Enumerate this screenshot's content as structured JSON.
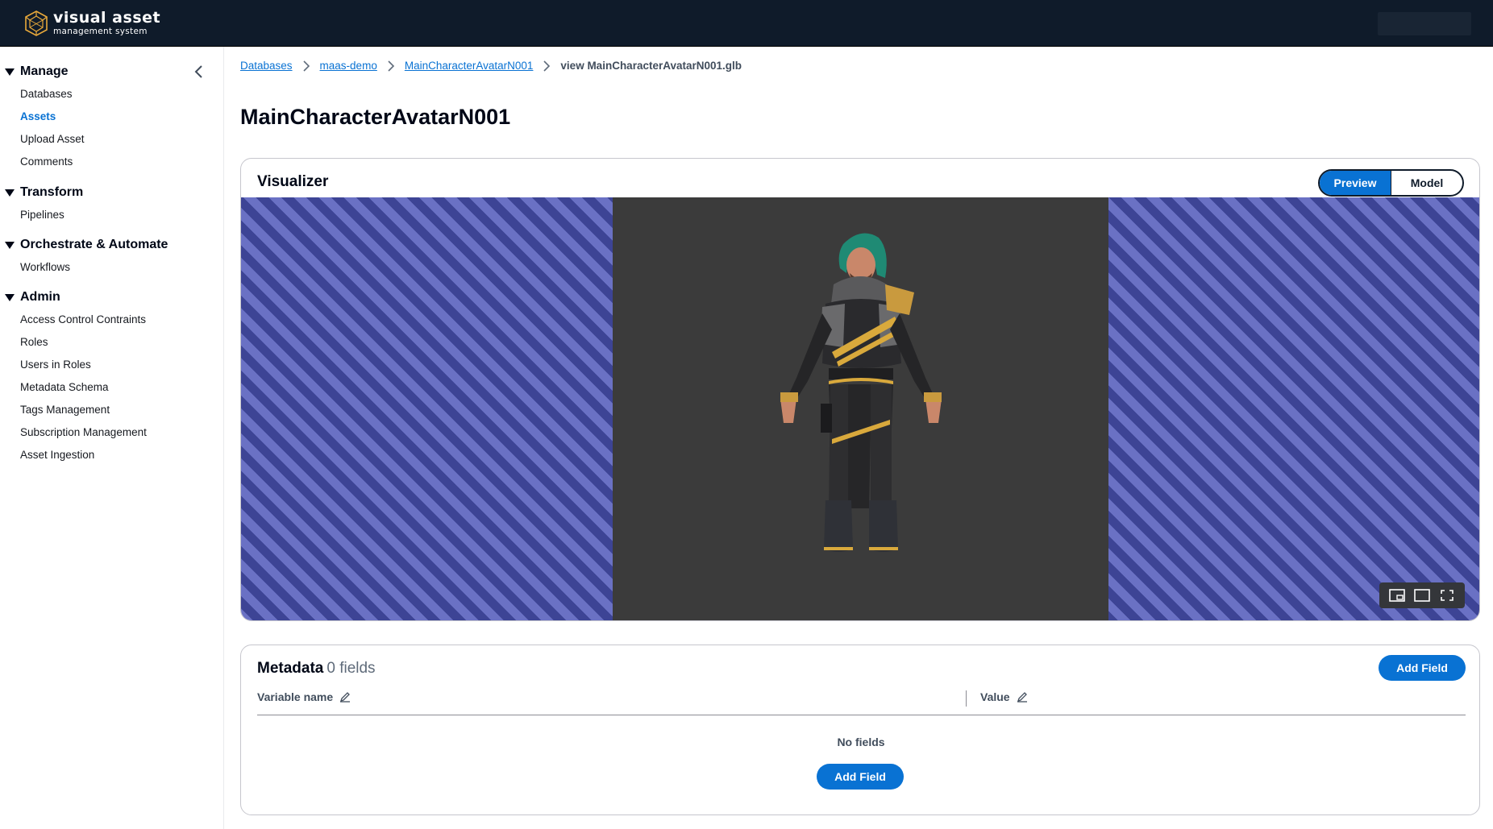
{
  "app": {
    "logo_title": "visual asset",
    "logo_subtitle": "management system"
  },
  "sidebar": {
    "sections": [
      {
        "title": "Manage",
        "items": [
          "Databases",
          "Assets",
          "Upload Asset",
          "Comments"
        ]
      },
      {
        "title": "Transform",
        "items": [
          "Pipelines"
        ]
      },
      {
        "title": "Orchestrate & Automate",
        "items": [
          "Workflows"
        ]
      },
      {
        "title": "Admin",
        "items": [
          "Access Control Contraints",
          "Roles",
          "Users in Roles",
          "Metadata Schema",
          "Tags Management",
          "Subscription Management",
          "Asset Ingestion"
        ]
      }
    ],
    "active_item": "Assets"
  },
  "breadcrumb": {
    "items": [
      "Databases",
      "maas-demo",
      "MainCharacterAvatarN001"
    ],
    "current": "view MainCharacterAvatarN001.glb"
  },
  "page": {
    "title": "MainCharacterAvatarN001"
  },
  "visualizer": {
    "title": "Visualizer",
    "modes": [
      "Preview",
      "Model"
    ],
    "active_mode": "Preview",
    "tools": [
      "picture-in-picture-icon",
      "window-icon",
      "fullscreen-icon"
    ]
  },
  "metadata": {
    "title": "Metadata",
    "count_label": "0 fields",
    "add_field_label": "Add Field",
    "columns": [
      "Variable name",
      "Value"
    ],
    "empty_label": "No fields",
    "empty_add_label": "Add Field"
  },
  "colors": {
    "accent": "#0972d3",
    "topbar": "#0f1b2a"
  }
}
